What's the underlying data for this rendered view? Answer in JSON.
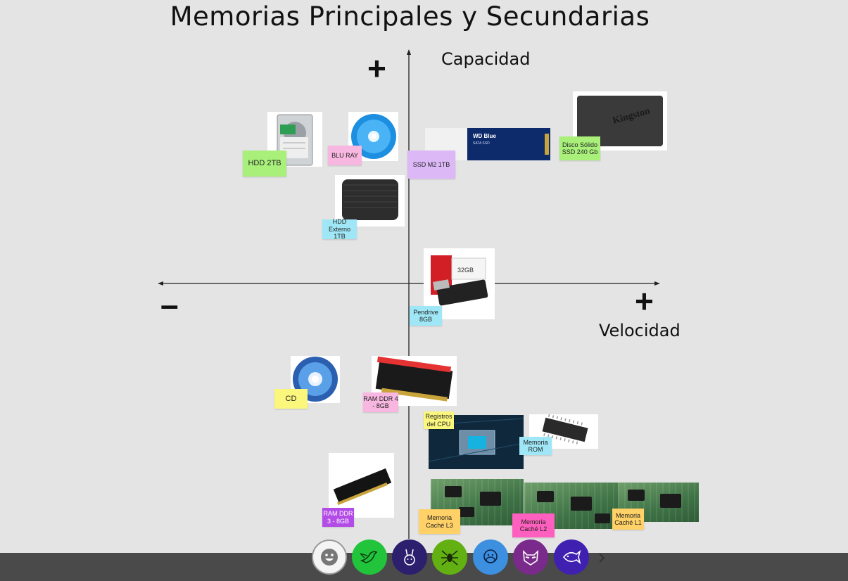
{
  "title": "Memorias Principales y Secundarias",
  "axes": {
    "y_label": "Capacidad",
    "x_label": "Velocidad",
    "plus_top": "+",
    "plus_right": "+",
    "minus_left": "–"
  },
  "stickies": {
    "hdd2tb": "HDD 2TB",
    "bluray": "BLU RAY",
    "ssd_m2": "SSD M2 1TB",
    "ssd_disk": "Disco Sólido SSD 240 Gb",
    "hdd_ext": "HDD Externo 1TB",
    "pendrive": "Pendrive 8GB",
    "cd": "CD",
    "ram_ddr4": "RAM DDR 4 - 8GB",
    "registros": "Registros del CPU",
    "rom": "Memoria ROM",
    "ram_ddr3": "RAM DDR 3 - 8GB",
    "cache_l3": "Memoria Caché L3",
    "cache_l2": "Memoria Caché L2",
    "cache_l1": "Memoria Caché L1"
  },
  "product_text": {
    "wd_brand": "WD Blue",
    "wd_sub": "SATA SSD",
    "kingston": "Kingston",
    "usb_cap": "32GB"
  },
  "colors": {
    "green_sticky": "#a8f07a",
    "pink_sticky": "#f8b7e0",
    "lavender_sticky": "#dcb8f7",
    "cyan_sticky": "#9fe7f7",
    "yellow_sticky": "#fbf77d",
    "magenta_sticky": "#ff5fbe",
    "orange_sticky": "#ffd166",
    "purple_sticky": "#b34ce6"
  },
  "toolbar": {
    "avatars": [
      {
        "icon": "smiley-icon",
        "bg": "#f4f4f4"
      },
      {
        "icon": "bird-icon",
        "bg": "#22c43c"
      },
      {
        "icon": "rabbit-icon",
        "bg": "#2b1f6e"
      },
      {
        "icon": "spider-icon",
        "bg": "#62b012"
      },
      {
        "icon": "monkey-icon",
        "bg": "#3d8fe0"
      },
      {
        "icon": "raccoon-icon",
        "bg": "#7a2a8a"
      },
      {
        "icon": "fish-icon",
        "bg": "#4020b0"
      }
    ],
    "next": "›"
  }
}
